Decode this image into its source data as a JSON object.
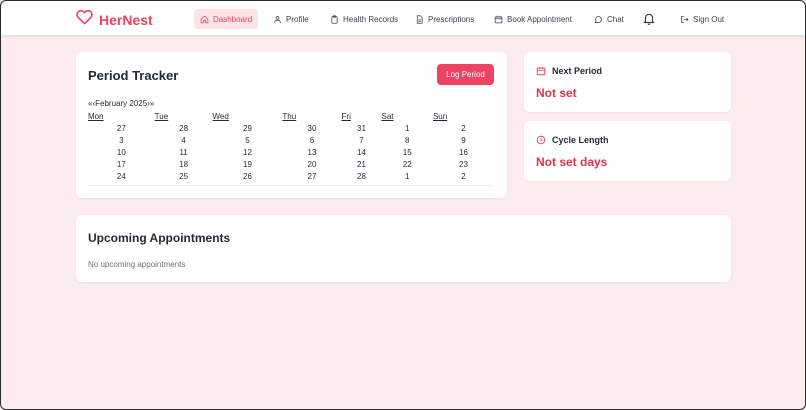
{
  "brand": {
    "name": "HerNest",
    "color": "#e8435f"
  },
  "nav": {
    "items": [
      {
        "label": "Dashboard",
        "icon": "home-icon",
        "active": true
      },
      {
        "label": "Profile",
        "icon": "user-icon"
      },
      {
        "label": "Health Records",
        "icon": "clipboard-icon"
      },
      {
        "label": "Prescriptions",
        "icon": "file-icon"
      },
      {
        "label": "Book Appointment",
        "icon": "calendar-icon"
      },
      {
        "label": "Chat",
        "icon": "chat-icon"
      }
    ],
    "notifications_icon": "bell-icon",
    "signout_label": "Sign Out",
    "signout_icon": "log-out-icon"
  },
  "tracker": {
    "title": "Period Tracker",
    "log_button": "Log Period",
    "calendar": {
      "prev": "«",
      "prev_small": "‹",
      "month": "February 2025",
      "next_small": "›",
      "next": "»",
      "weekdays": [
        "Mon",
        "Tue",
        "Wed",
        "Thu",
        "Fri",
        "Sat",
        "Sun"
      ],
      "weeks": [
        [
          "27",
          "28",
          "29",
          "30",
          "31",
          "1",
          "2"
        ],
        [
          "3",
          "4",
          "5",
          "6",
          "7",
          "8",
          "9"
        ],
        [
          "10",
          "11",
          "12",
          "13",
          "14",
          "15",
          "16"
        ],
        [
          "17",
          "18",
          "19",
          "20",
          "21",
          "22",
          "23"
        ],
        [
          "24",
          "25",
          "26",
          "27",
          "28",
          "1",
          "2"
        ]
      ]
    }
  },
  "next_period": {
    "label": "Next Period",
    "value": "Not set",
    "icon": "calendar-icon"
  },
  "cycle_length": {
    "label": "Cycle Length",
    "value": "Not set days",
    "icon": "clock-icon"
  },
  "appointments": {
    "title": "Upcoming Appointments",
    "empty": "No upcoming appointments"
  },
  "colors": {
    "accent": "#ee4462",
    "background": "#fdeced",
    "value_red": "#e0314f"
  }
}
